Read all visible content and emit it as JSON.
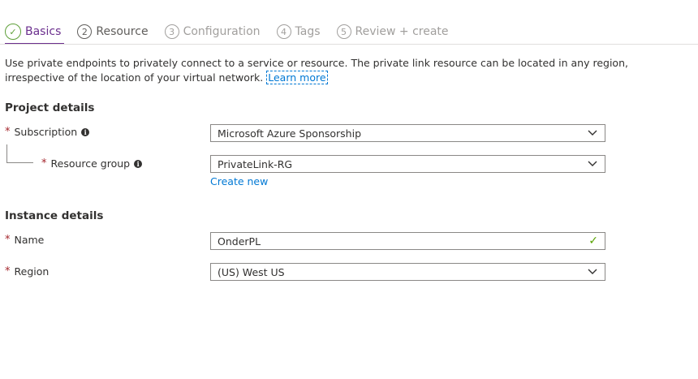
{
  "tabs": [
    {
      "num": "✓",
      "label": "Basics"
    },
    {
      "num": "2",
      "label": "Resource"
    },
    {
      "num": "3",
      "label": "Configuration"
    },
    {
      "num": "4",
      "label": "Tags"
    },
    {
      "num": "5",
      "label": "Review + create"
    }
  ],
  "description": {
    "line1": "Use private endpoints to privately connect to a service or resource. The private link resource can be located in any region,",
    "line2": "irrespective of the location of your virtual network.",
    "learn_more": "Learn more"
  },
  "project": {
    "heading": "Project details",
    "subscription": {
      "label": "Subscription",
      "value": "Microsoft Azure Sponsorship"
    },
    "resource_group": {
      "label": "Resource group",
      "value": "PrivateLink-RG",
      "create_new": "Create new"
    }
  },
  "instance": {
    "heading": "Instance details",
    "name": {
      "label": "Name",
      "value": "OnderPL"
    },
    "region": {
      "label": "Region",
      "value": "(US) West US"
    }
  },
  "required_mark": "*",
  "colors": {
    "accent": "#6b2f8e",
    "link": "#0078d4",
    "success": "#57a300",
    "required": "#a4262c"
  }
}
